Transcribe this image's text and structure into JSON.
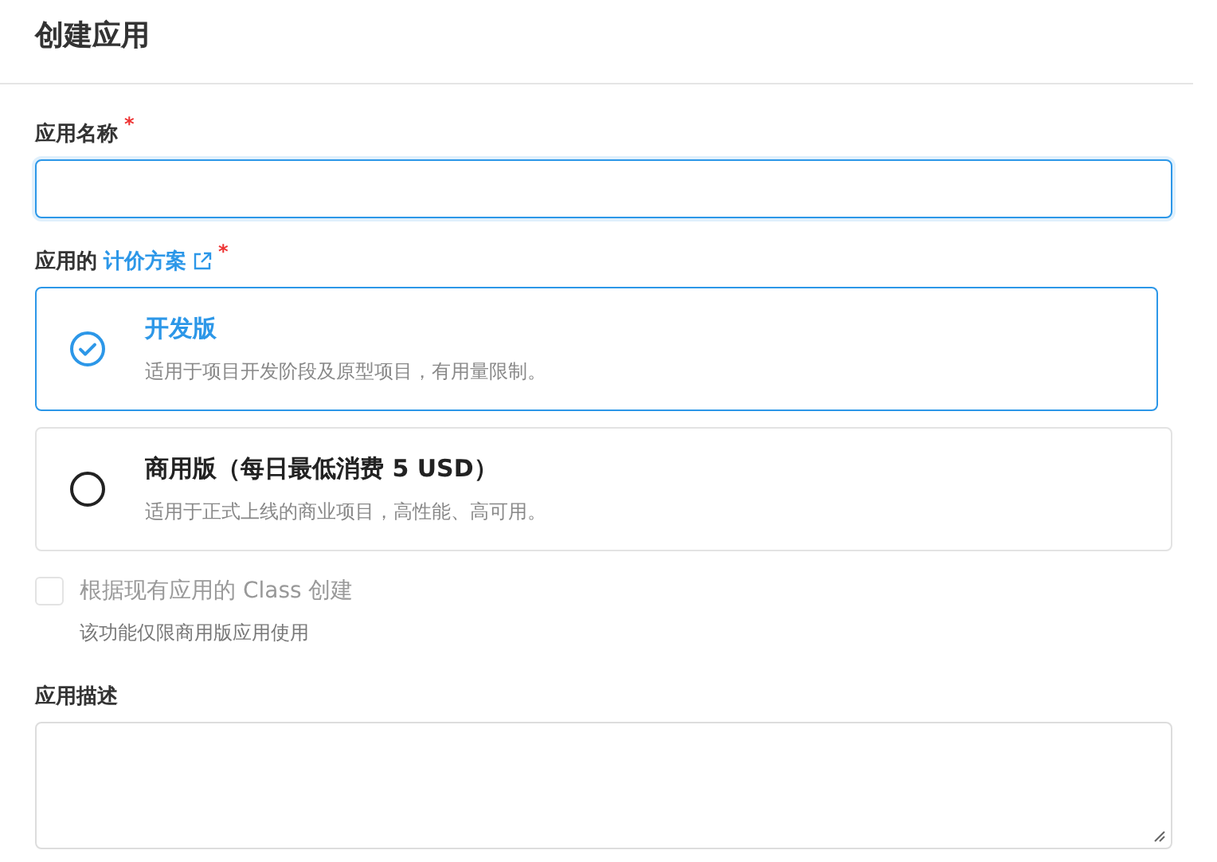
{
  "title": "创建应用",
  "name_field": {
    "label": "应用名称",
    "required_mark": "*",
    "focused": true
  },
  "plan_field": {
    "label": "应用的",
    "link": "计价方案",
    "required_mark": "*"
  },
  "plans": [
    {
      "name": "开发版",
      "description": "适用于项目开发阶段及原型项目，有用量限制。",
      "selected": true
    },
    {
      "name": "商用版（每日最低消费 5 USD）",
      "description": "适用于正式上线的商业项目，高性能、高可用。",
      "selected": false
    }
  ],
  "class_option": {
    "label": "根据现有应用的 Class 创建",
    "checked": false,
    "disabled": true,
    "hint": "该功能仅限商用版应用使用"
  },
  "description_field": {
    "label": "应用描述"
  }
}
